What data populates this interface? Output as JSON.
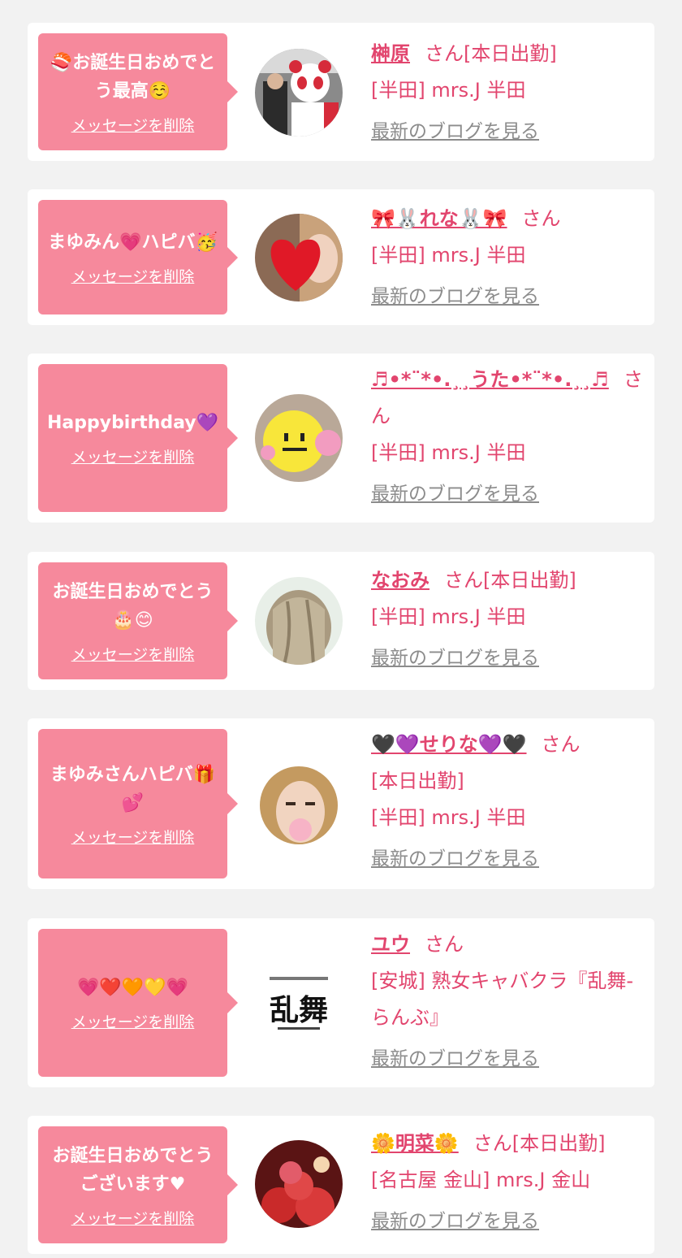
{
  "delete_label": "メッセージを削除",
  "blog_label": "最新のブログを見る",
  "san_label": "さん",
  "messages": [
    {
      "bubble_text": "🍣お誕生日おめでとう最高☺️",
      "name": "榊原",
      "status": "[本日出勤]",
      "store": "[半田] mrs.J 半田",
      "avatar": "panda-mascot-photo"
    },
    {
      "bubble_text": "まゆみん💗ハピバ🥳",
      "name": "🎀🐰れな🐰🎀",
      "status": "",
      "store": "[半田] mrs.J 半田",
      "avatar": "heart-face-photo"
    },
    {
      "bubble_text": "Happybirthday💜",
      "name": "♬•*¨*•.¸¸うた•*¨*•.¸¸♬",
      "status": "",
      "store": "[半田] mrs.J 半田",
      "avatar": "smiley-face-photo"
    },
    {
      "bubble_text": "お誕生日おめでとう🎂😊",
      "name": "なおみ",
      "status": "[本日出勤]",
      "store": "[半田] mrs.J 半田",
      "avatar": "hair-photo"
    },
    {
      "bubble_text": "まゆみさんハピバ🎁💕",
      "name": "🖤💜せりな💜🖤",
      "status": "[本日出勤]",
      "store": "[半田] mrs.J 半田",
      "avatar": "blurred-face-photo"
    },
    {
      "bubble_text": "💗❤️🧡💛💗",
      "name": "ユウ",
      "status": "",
      "store": "[安城] 熟女キャバクラ『乱舞-らんぶ』",
      "avatar": "ranbu-logo",
      "logo_text": "乱舞"
    },
    {
      "bubble_text": "お誕生日おめでとうございます♥",
      "name": "🌼明菜🌼",
      "status": "[本日出勤]",
      "store": "[名古屋 金山] mrs.J 金山",
      "avatar": "red-flower-photo"
    }
  ]
}
